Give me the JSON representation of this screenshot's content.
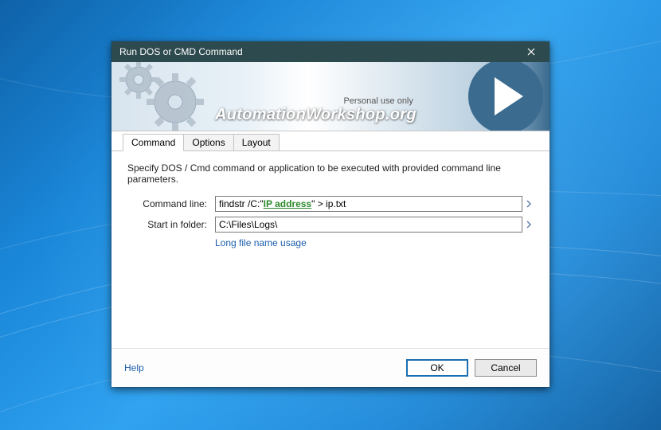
{
  "window": {
    "title": "Run DOS or CMD Command"
  },
  "banner": {
    "tagline": "Personal use only",
    "brand_prefix": "Automation",
    "brand_suffix": "Workshop",
    "brand_domain": ".org"
  },
  "tabs": {
    "command": "Command",
    "options": "Options",
    "layout": "Layout"
  },
  "content": {
    "description": "Specify DOS / Cmd command or application to be executed with provided command line parameters.",
    "cmd_label": "Command line:",
    "cmd_prefix": "findstr /C:\"",
    "cmd_var": "IP address",
    "cmd_suffix": "\" > ip.txt",
    "folder_label": "Start in folder:",
    "folder_value": "C:\\Files\\Logs\\",
    "link_text": "Long file name usage"
  },
  "footer": {
    "help": "Help",
    "ok": "OK",
    "cancel": "Cancel"
  }
}
